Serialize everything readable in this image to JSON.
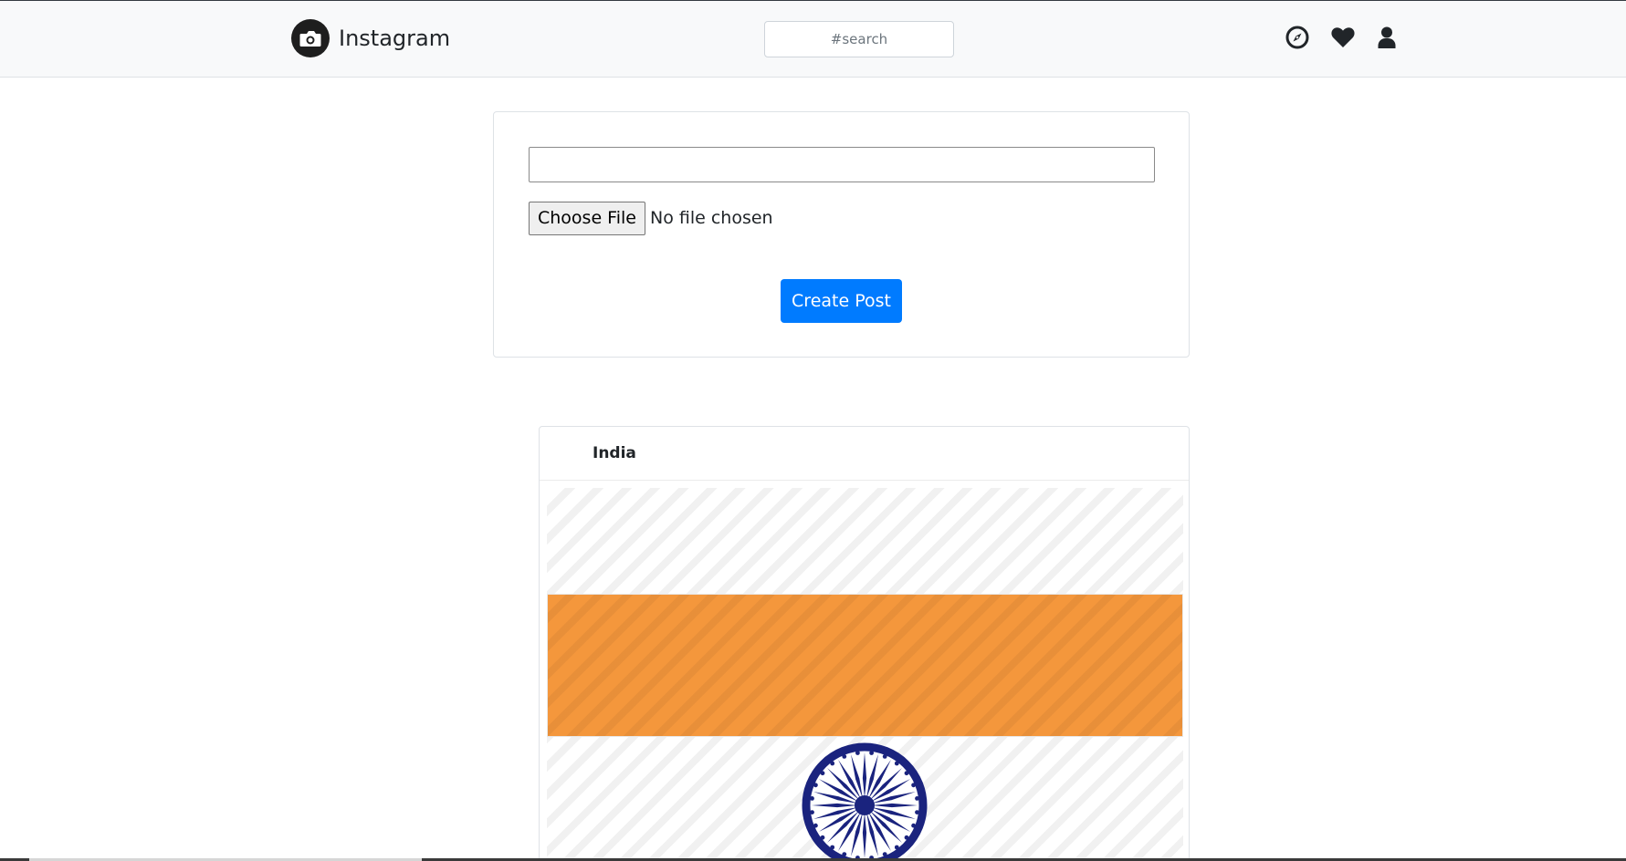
{
  "header": {
    "brand": "Instagram",
    "search_placeholder": "#search",
    "icons": [
      "camera-icon",
      "compass-icon",
      "heart-icon",
      "user-icon"
    ]
  },
  "create_post": {
    "caption_value": "",
    "file_button_label": "Choose File",
    "file_status": "No file chosen",
    "submit_label": "Create Post"
  },
  "post": {
    "author": "India",
    "image": "flag-of-india",
    "flag_colors": {
      "saffron": "#f4973c",
      "chakra": "#1a237e"
    }
  },
  "colors": {
    "navbar_bg": "#f8f9fa",
    "accent": "#007bff",
    "text": "#212529"
  }
}
